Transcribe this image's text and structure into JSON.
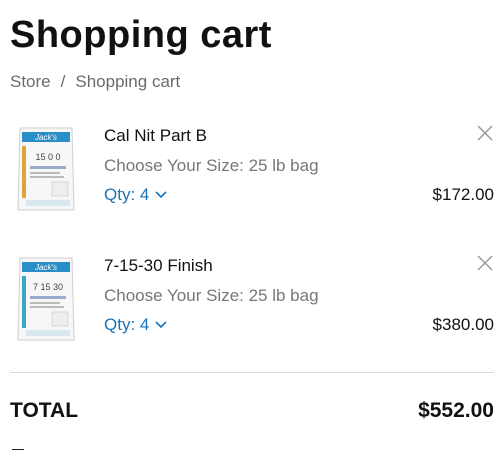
{
  "page": {
    "title": "Shopping cart",
    "breadcrumb": [
      "Store",
      "Shopping cart"
    ],
    "breadcrumb_separator": "/"
  },
  "cart": {
    "items": [
      {
        "name": "Cal Nit Part B",
        "variant": "Choose Your Size: 25 lb bag",
        "qty_label": "Qty: 4",
        "price": "$172.00",
        "thumb": {
          "brand": "Jack's",
          "code": "15 0 0",
          "accent": "#e0a33a"
        }
      },
      {
        "name": "7-15-30 Finish",
        "variant": "Choose Your Size: 25 lb bag",
        "qty_label": "Qty: 4",
        "price": "$380.00",
        "thumb": {
          "brand": "Jack's",
          "code": "7 15 30",
          "accent": "#3aa6c4"
        }
      }
    ],
    "total_label": "TOTAL",
    "total_value": "$552.00"
  },
  "colors": {
    "link": "#1a73b8",
    "text": "#111111",
    "muted": "#777777",
    "divider": "#d9d9d9"
  },
  "icons": {
    "remove": "close-icon",
    "qty_dropdown": "chevron-down-icon"
  }
}
